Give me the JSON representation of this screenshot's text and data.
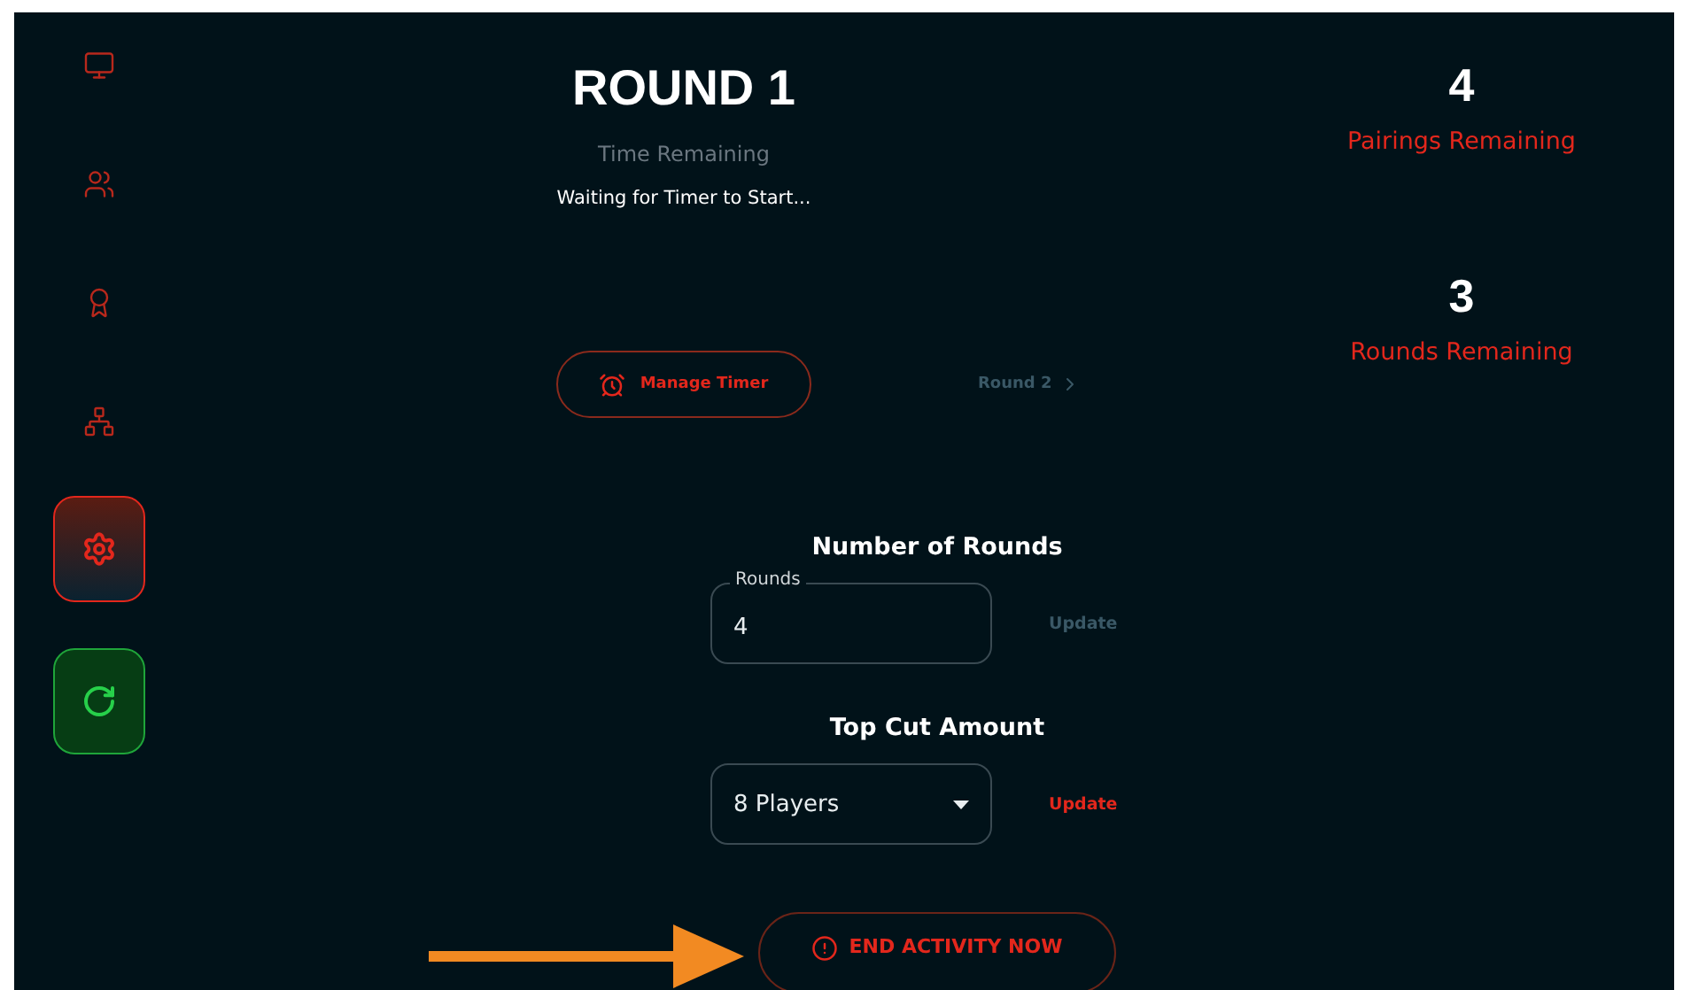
{
  "sidebar": {
    "items": [
      {
        "kind": "icon",
        "selected": false
      },
      {
        "kind": "icon",
        "selected": false
      },
      {
        "kind": "icon",
        "selected": false
      },
      {
        "kind": "icon",
        "selected": false
      },
      {
        "kind": "button",
        "selected": true
      },
      {
        "kind": "action",
        "selected": false
      }
    ]
  },
  "round": {
    "title": "ROUND 1",
    "timer_label": "Time Remaining",
    "timer_status": "Waiting for Timer to Start...",
    "manage_button": "Manage Timer",
    "next_round": {
      "label": "Round 2",
      "disabled": true
    }
  },
  "stats": [
    {
      "value": "4",
      "label": "Pairings Remaining"
    },
    {
      "value": "3",
      "label": "Rounds Remaining"
    }
  ],
  "settings": [
    {
      "kind": "input",
      "title": "Number of Rounds",
      "field_label": "Rounds",
      "value": "4",
      "update": {
        "label": "Update",
        "disabled": true
      }
    },
    {
      "kind": "select",
      "title": "Top Cut Amount",
      "value": "8 Players",
      "update": {
        "label": "Update",
        "disabled": false
      }
    }
  ],
  "end_button": "END ACTIVITY NOW"
}
